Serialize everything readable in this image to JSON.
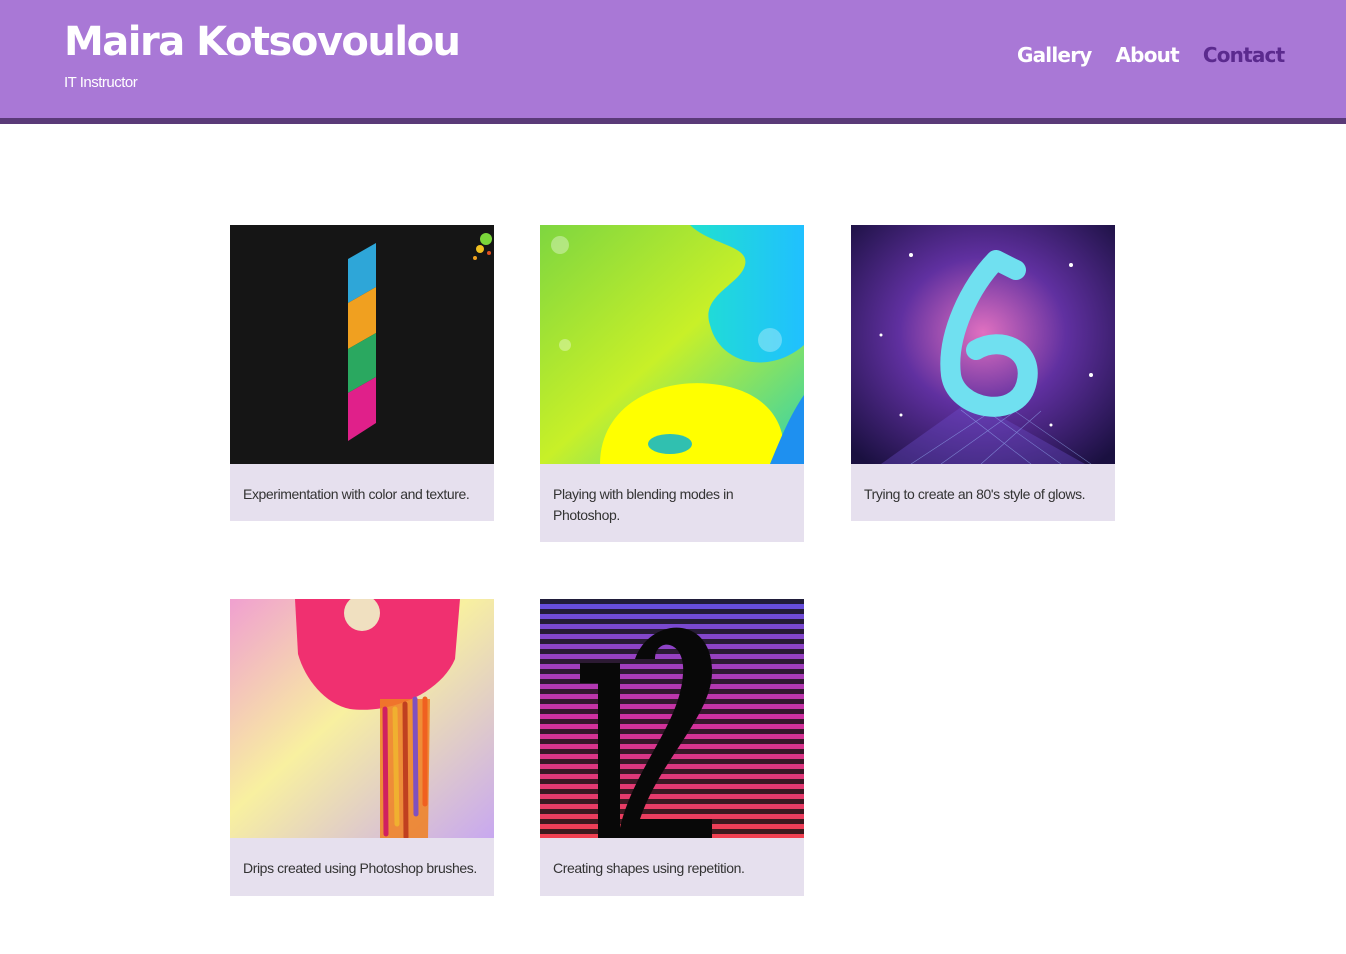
{
  "header": {
    "title": "Maira Kotsovoulou",
    "subtitle": "IT Instructor",
    "bg_color": "#a978d6",
    "nav": [
      {
        "label": "Gallery",
        "active": false
      },
      {
        "label": "About",
        "active": false
      },
      {
        "label": "Contact",
        "active": true
      }
    ]
  },
  "gallery": {
    "items": [
      {
        "number": "1",
        "caption": "Experimentation with color and texture."
      },
      {
        "number": "8",
        "caption": "Playing with blending modes in Photoshop."
      },
      {
        "number": "6",
        "caption": "Trying to create an 80's style of glows."
      },
      {
        "number": "9",
        "caption": "Drips created using Photoshop brushes."
      },
      {
        "number": "12",
        "caption": "Creating shapes using repetition."
      }
    ]
  }
}
